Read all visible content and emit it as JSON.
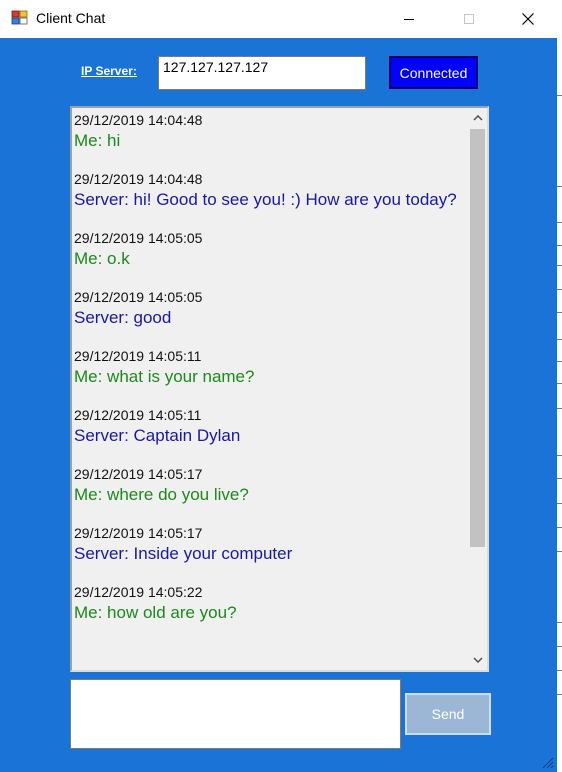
{
  "window": {
    "title": "Client Chat",
    "icon": "app-window-icon",
    "controls": [
      "minimize-icon",
      "maximize-icon",
      "close-icon"
    ]
  },
  "connection": {
    "ip_label": "IP Server:",
    "ip_value": "127.127.127.127",
    "connect_label": "Connected"
  },
  "messages": [
    {
      "sender": "me",
      "time": "29/12/2019 14:04:48",
      "text": "Me: hi"
    },
    {
      "sender": "server",
      "time": "29/12/2019 14:04:48",
      "text": "Server: hi! Good to see you! :) How are you today?"
    },
    {
      "sender": "me",
      "time": "29/12/2019 14:05:05",
      "text": "Me: o.k"
    },
    {
      "sender": "server",
      "time": "29/12/2019 14:05:05",
      "text": "Server: good"
    },
    {
      "sender": "me",
      "time": "29/12/2019 14:05:11",
      "text": "Me: what is your name?"
    },
    {
      "sender": "server",
      "time": "29/12/2019 14:05:11",
      "text": "Server: Captain Dylan"
    },
    {
      "sender": "me",
      "time": "29/12/2019 14:05:17",
      "text": "Me: where do you live?"
    },
    {
      "sender": "server",
      "time": "29/12/2019 14:05:17",
      "text": "Server: Inside your computer"
    },
    {
      "sender": "me",
      "time": "29/12/2019 14:05:22",
      "text": "Me: how old are you?"
    }
  ],
  "composer": {
    "value": "",
    "send_label": "Send"
  },
  "colors": {
    "background": "#1a74d8",
    "me_text": "#1b8a1b",
    "server_text": "#1818a8",
    "connect_button": "#0000ff",
    "send_button_disabled": "#9cb6d6"
  }
}
